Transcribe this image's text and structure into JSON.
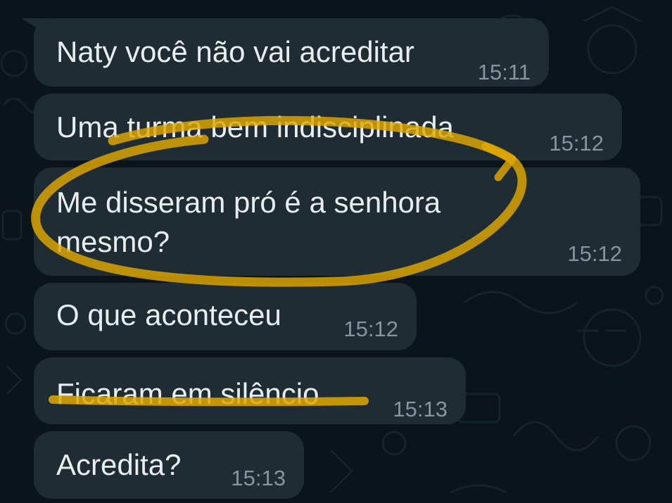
{
  "colors": {
    "background": "#0b141a",
    "bubble": "#1f2c34",
    "text": "#e9edef",
    "time": "#8696a0",
    "highlight": "#e0a800"
  },
  "messages": [
    {
      "text": "Naty você não vai acreditar",
      "time": "15:11"
    },
    {
      "text": "Uma turma bem indisciplinada",
      "time": "15:12"
    },
    {
      "text_line1": "Me disseram pró é a senhora",
      "text_line2": "mesmo?",
      "time": "15:12"
    },
    {
      "text": "O que aconteceu",
      "time": "15:12"
    },
    {
      "text": "Ficaram em silêncio",
      "time": "15:13"
    },
    {
      "text": "Acredita?",
      "time": "15:13"
    }
  ]
}
